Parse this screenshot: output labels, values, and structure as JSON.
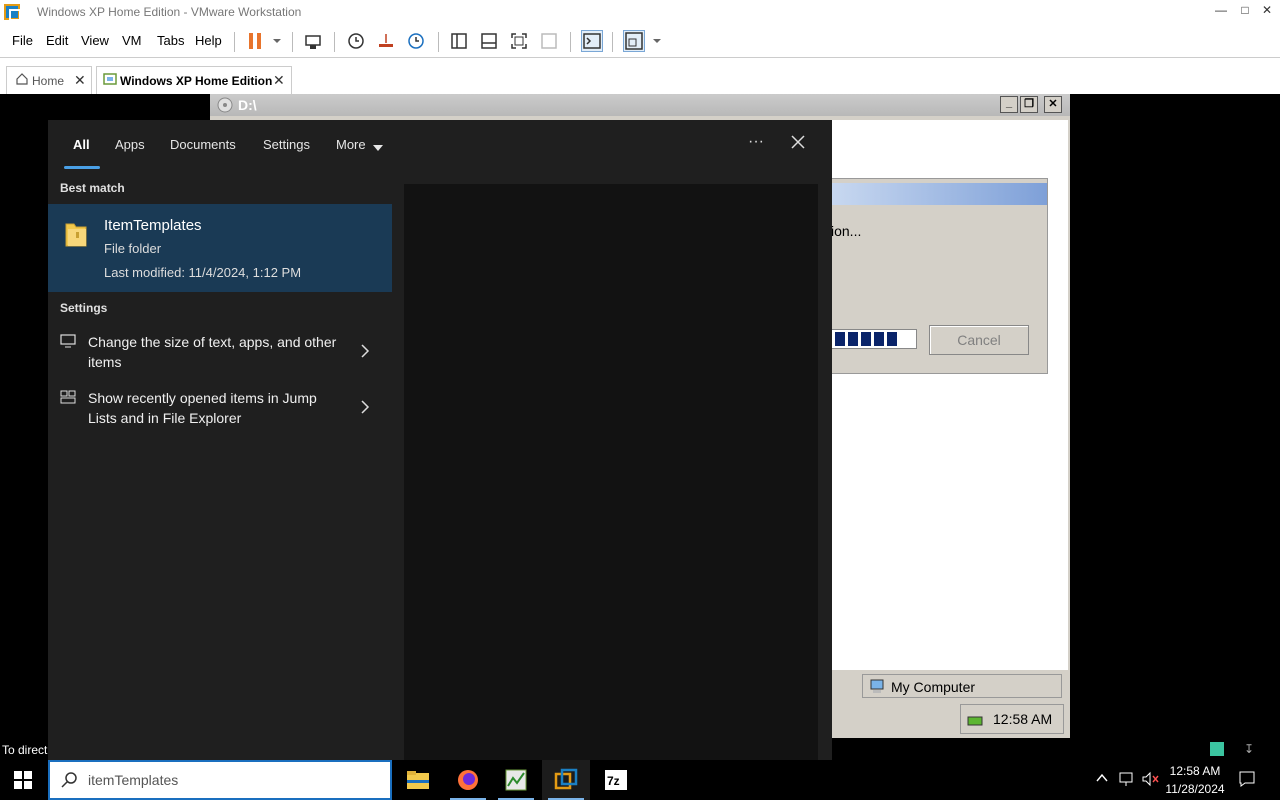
{
  "vmware": {
    "title": "Windows XP Home Edition - VMware Workstation",
    "menu": [
      "File",
      "Edit",
      "View",
      "VM",
      "Tabs",
      "Help"
    ],
    "tabs": [
      {
        "label": "Home"
      },
      {
        "label": "Windows XP Home Edition"
      }
    ],
    "status_text": "To direct"
  },
  "xp": {
    "window_title": "D:\\",
    "dialog_text": "ion...",
    "cancel_label": "Cancel",
    "statusbar_location": "My Computer",
    "tray_time": "12:58 AM"
  },
  "search": {
    "filters": [
      "All",
      "Apps",
      "Documents",
      "Settings",
      "More"
    ],
    "active_filter": "All",
    "more_dots": "···",
    "best_match_heading": "Best match",
    "best_match": {
      "name": "ItemTemplates",
      "type": "File folder",
      "modified": "Last modified: 11/4/2024, 1:12 PM"
    },
    "settings_heading": "Settings",
    "settings": [
      {
        "label": "Change the size of text, apps, and other items",
        "icon": "monitor-icon"
      },
      {
        "label": "Show recently opened items in Jump Lists and in File Explorer",
        "icon": "jumplist-icon"
      }
    ],
    "query": "itemTemplates"
  },
  "taskbar": {
    "apps": [
      "File Explorer",
      "Firefox",
      "Task app",
      "VMware Workstation",
      "7-Zip"
    ],
    "clock_time": "12:58 AM",
    "clock_date": "11/28/2024"
  },
  "colors": {
    "accent": "#1a6fbf",
    "best_match_bg": "#1a3a55",
    "panel_bg": "#1f1f1f"
  }
}
